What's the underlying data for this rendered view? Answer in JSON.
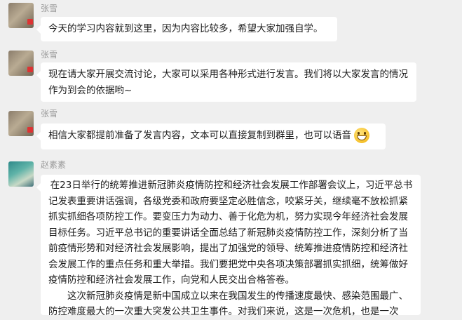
{
  "messages": [
    {
      "sender": "张雪",
      "text": "今天的学习内容就到这里，因为内容比较多，希望大家加强自学。"
    },
    {
      "sender": "张雪",
      "text": "现在请大家开展交流讨论，大家可以采用各种形式进行发言。我们将以大家发言的情况作为到会的依据哟~"
    },
    {
      "sender": "张雪",
      "text": "相信大家都提前准备了发言内容，文本可以直接复制到群里，也可以语音",
      "emoji": "grin-emoji"
    },
    {
      "sender": "赵素素",
      "paragraphs": [
        "在23日举行的统筹推进新冠肺炎疫情防控和经济社会发展工作部署会议上，习近平总书记发表重要讲话强调，各级党委和政府要坚定必胜信念，咬紧牙关，继续毫不放松抓紧抓实抓细各项防控工作。要变压力为动力、善于化危为机，努力实现今年经济社会发展目标任务。习近平总书记的重要讲话全面总结了新冠肺炎疫情防控工作，深刻分析了当前疫情形势和对经济社会发展影响，提出了加强党的领导、统筹推进疫情防控和经济社会发展工作的重点任务和重大举措。我们要把党中央各项决策部署抓实抓细，统筹做好疫情防控和经济社会发展工作，向党和人民交出合格答卷。",
        "这次新冠肺炎疫情是新中国成立以来在我国发生的传播速度最快、感染范围最广、防控难度最大的一次重大突发公共卫生事件。对我们来说，这是一次危机，也是一次"
      ]
    }
  ]
}
